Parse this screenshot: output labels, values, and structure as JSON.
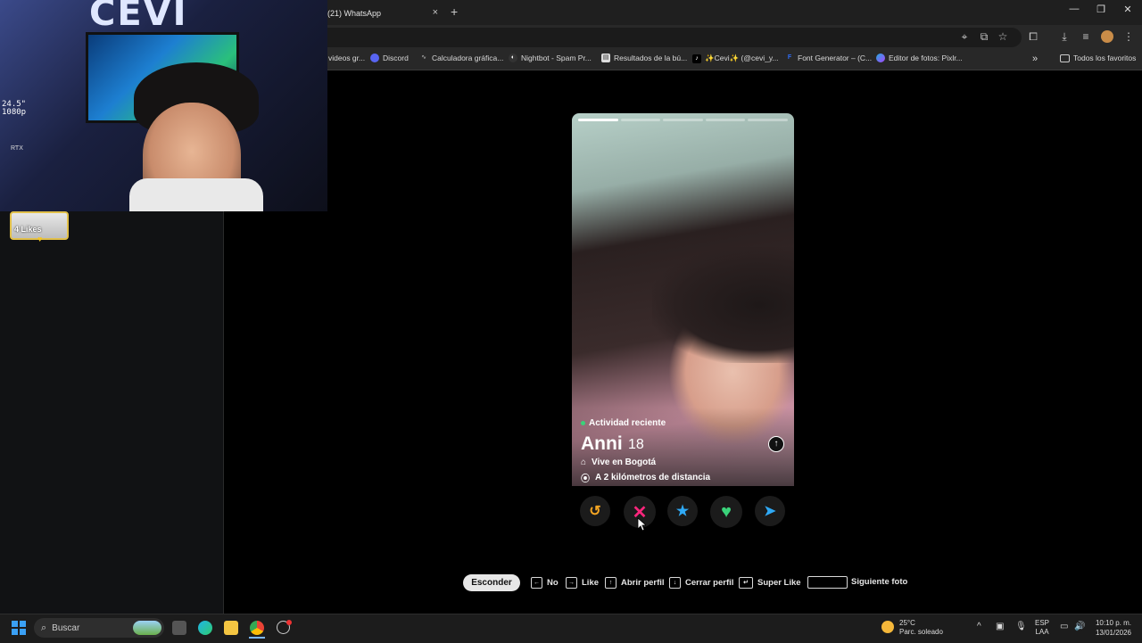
{
  "browser": {
    "tab_title": "(21) WhatsApp",
    "new_tab_symbol": "+",
    "close_tab_symbol": "×",
    "window_controls": {
      "minimize": "—",
      "restore": "❐",
      "close": "✕"
    },
    "bookmarks": [
      {
        "label": "videos gr...",
        "icon": "folder-icon"
      },
      {
        "label": "Discord",
        "icon": "discord-icon"
      },
      {
        "label": "Calculadora gráfica...",
        "icon": "calculator-icon"
      },
      {
        "label": "Nightbot - Spam Pr...",
        "icon": "nightbot-icon"
      },
      {
        "label": "Resultados de la bú...",
        "icon": "search-results-icon"
      },
      {
        "label": "✨Cevi✨ (@cevi_y...",
        "icon": "tiktok-icon"
      },
      {
        "label": "Font Generator – (C...",
        "icon": "font-icon"
      },
      {
        "label": "Editor de fotos: Pixlr...",
        "icon": "pixlr-icon"
      }
    ],
    "bookmarks_overflow": "»",
    "all_bookmarks": "Todos los favoritos"
  },
  "webcam": {
    "logo_text": "CEVI",
    "resolution_text_1": "24.5\"",
    "resolution_text_2": "1080p",
    "rtx_text": "RTX"
  },
  "left_panel": {
    "likes_label": "4 Likes"
  },
  "profile": {
    "photo_count": 5,
    "current_photo": 1,
    "activity": "Actividad reciente",
    "name": "Anni",
    "age": "18",
    "lives_in": "Vive en Bogotá",
    "distance": "A 2 kilómetros de distancia",
    "expand_symbol": "↑"
  },
  "actions": {
    "rewind": {
      "symbol": "↺",
      "color": "#f5a623"
    },
    "nope": {
      "symbol": "✕",
      "color": "#fd267d"
    },
    "super_like": {
      "symbol": "★",
      "color": "#2fa9f5"
    },
    "like": {
      "symbol": "♥",
      "color": "#3ad27a"
    },
    "boost": {
      "symbol": "➤",
      "color": "#2fa9f5"
    }
  },
  "shortcuts": {
    "hide_button": "Esconder",
    "items": [
      {
        "key": "←",
        "label": "No"
      },
      {
        "key": "→",
        "label": "Like"
      },
      {
        "key": "↑",
        "label": "Abrir perfil"
      },
      {
        "key": "↓",
        "label": "Cerrar perfil"
      },
      {
        "key": "↵",
        "label": "Super Like"
      },
      {
        "key": "",
        "label": "Siguiente foto"
      }
    ]
  },
  "taskbar": {
    "search_placeholder": "Buscar",
    "weather_temp": "25°C",
    "weather_desc": "Parc. soleado",
    "lang_1": "ESP",
    "lang_2": "LAA",
    "time": "10:10 p. m.",
    "date": "13/01/2026"
  }
}
